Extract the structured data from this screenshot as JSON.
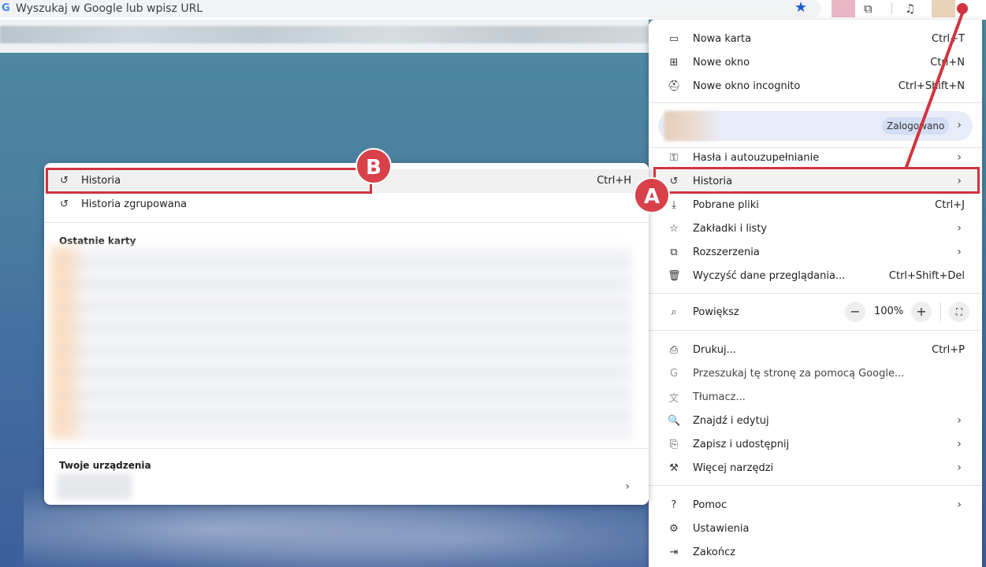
{
  "omnibox": {
    "placeholder": "Wyszukaj w Google lub wpisz URL"
  },
  "menu": {
    "items": [
      {
        "icon": "new-tab-icon",
        "label": "Nowa karta",
        "shortcut": "Ctrl+T"
      },
      {
        "icon": "new-window-icon",
        "label": "Nowe okno",
        "shortcut": "Ctrl+N"
      },
      {
        "icon": "incognito-icon",
        "label": "Nowe okno incognito",
        "shortcut": "Ctrl+Shift+N"
      },
      {
        "icon": "key-icon",
        "label": "Hasła i autouzupełnianie"
      },
      {
        "icon": "history-icon",
        "label": "Historia"
      },
      {
        "icon": "download-icon",
        "label": "Pobrane pliki",
        "shortcut": "Ctrl+J"
      },
      {
        "icon": "star-icon",
        "label": "Zakładki i listy"
      },
      {
        "icon": "extension-icon",
        "label": "Rozszerzenia"
      },
      {
        "icon": "trash-icon",
        "label": "Wyczyść dane przeglądania...",
        "shortcut": "Ctrl+Shift+Del"
      },
      {
        "icon": "zoom-icon",
        "label": "Powiększ"
      },
      {
        "icon": "print-icon",
        "label": "Drukuj...",
        "shortcut": "Ctrl+P"
      },
      {
        "icon": "google-icon",
        "label": "Przeszukaj tę stronę za pomocą Google..."
      },
      {
        "icon": "translate-icon",
        "label": "Tłumacz..."
      },
      {
        "icon": "find-icon",
        "label": "Znajdź i edytuj"
      },
      {
        "icon": "save-share-icon",
        "label": "Zapisz i udostępnij"
      },
      {
        "icon": "tools-icon",
        "label": "Więcej narzędzi"
      },
      {
        "icon": "help-icon",
        "label": "Pomoc"
      },
      {
        "icon": "settings-icon",
        "label": "Ustawienia"
      },
      {
        "icon": "exit-icon",
        "label": "Zakończ"
      }
    ],
    "profile_badge": "Zalogowano",
    "zoom": {
      "minus": "−",
      "value": "100%",
      "plus": "+"
    }
  },
  "submenu": {
    "historia": {
      "label": "Historia",
      "shortcut": "Ctrl+H"
    },
    "grouped": {
      "label": "Historia zgrupowana"
    },
    "recent_tabs_header": "Ostatnie karty",
    "devices_header": "Twoje urządzenia"
  },
  "annotations": {
    "a": "A",
    "b": "B",
    "color": "#d1343f"
  }
}
